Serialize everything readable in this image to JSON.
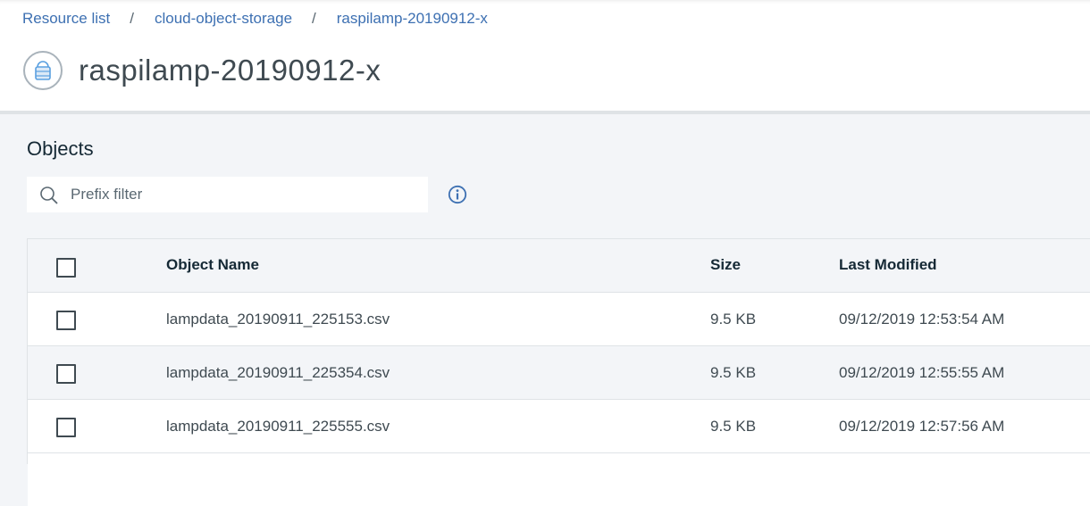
{
  "breadcrumb": {
    "items": [
      "Resource list",
      "cloud-object-storage",
      "raspilamp-20190912-x"
    ],
    "separator": "/"
  },
  "page": {
    "title": "raspilamp-20190912-x",
    "icon": "bucket-icon"
  },
  "objects_section": {
    "title": "Objects",
    "search": {
      "value": "",
      "placeholder": "Prefix filter",
      "icon": "search-icon"
    },
    "info_icon": "info-icon"
  },
  "table": {
    "columns": [
      "Object Name",
      "Size",
      "Last Modified"
    ],
    "rows": [
      {
        "name": "lampdata_20190911_225153.csv",
        "size": "9.5 KB",
        "modified": "09/12/2019 12:53:54 AM"
      },
      {
        "name": "lampdata_20190911_225354.csv",
        "size": "9.5 KB",
        "modified": "09/12/2019 12:55:55 AM"
      },
      {
        "name": "lampdata_20190911_225555.csv",
        "size": "9.5 KB",
        "modified": "09/12/2019 12:57:56 AM"
      }
    ]
  },
  "colors": {
    "link": "#3d70b2",
    "background": "#f3f5f8",
    "text": "#152935",
    "border": "#dfe3e6"
  }
}
